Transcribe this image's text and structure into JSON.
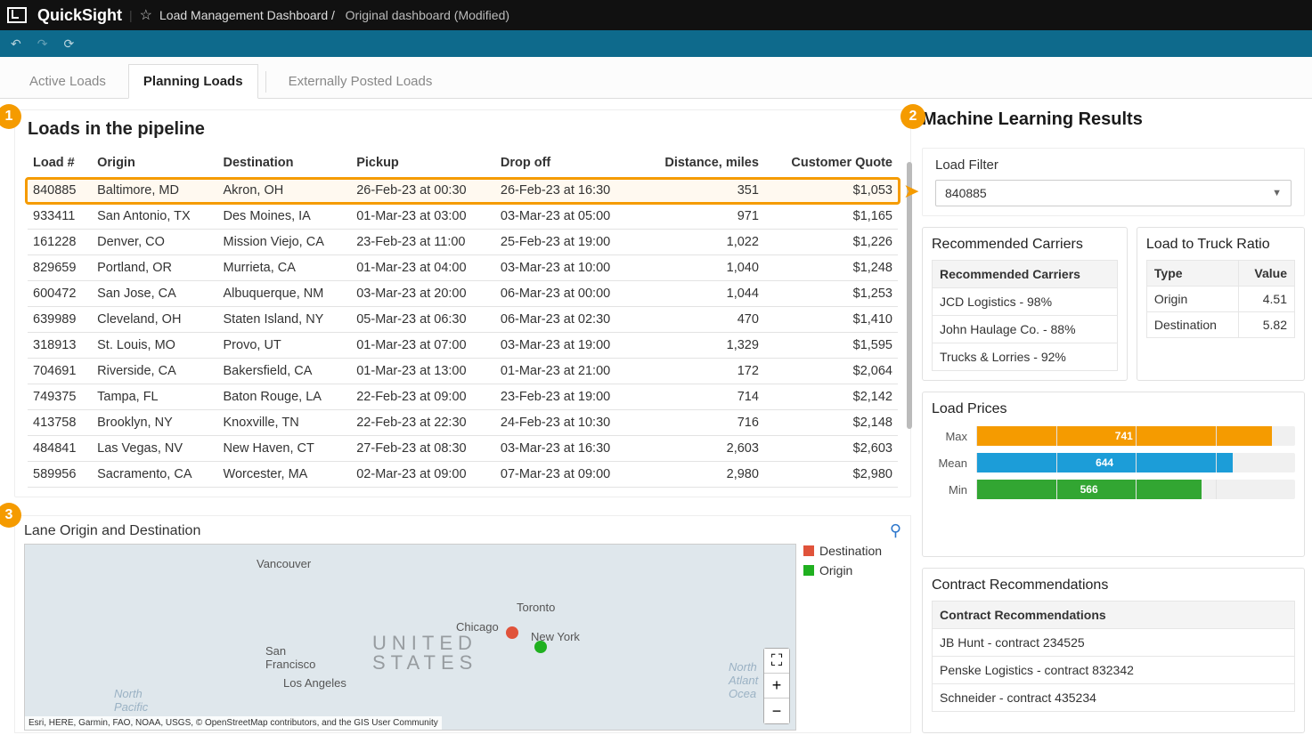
{
  "brand": "QuickSight",
  "breadcrumb": {
    "parent": "Load Management Dashboard /",
    "current": "Original dashboard (Modified)"
  },
  "tabs": [
    "Active Loads",
    "Planning Loads",
    "Externally Posted Loads"
  ],
  "active_tab": 1,
  "badges": {
    "b1": "1",
    "b2": "2",
    "b3": "3"
  },
  "pipeline": {
    "title": "Loads in the pipeline",
    "columns": [
      "Load #",
      "Origin",
      "Destination",
      "Pickup",
      "Drop off",
      "Distance, miles",
      "Customer Quote"
    ],
    "rows": [
      {
        "load": "840885",
        "origin": "Baltimore, MD",
        "dest": "Akron, OH",
        "pickup": "26-Feb-23 at 00:30",
        "dropoff": "26-Feb-23 at 16:30",
        "dist": "351",
        "quote": "$1,053",
        "hl": true
      },
      {
        "load": "933411",
        "origin": "San Antonio, TX",
        "dest": "Des Moines, IA",
        "pickup": "01-Mar-23 at 03:00",
        "dropoff": "03-Mar-23 at 05:00",
        "dist": "971",
        "quote": "$1,165"
      },
      {
        "load": "161228",
        "origin": "Denver, CO",
        "dest": "Mission Viejo, CA",
        "pickup": "23-Feb-23 at 11:00",
        "dropoff": "25-Feb-23 at 19:00",
        "dist": "1,022",
        "quote": "$1,226"
      },
      {
        "load": "829659",
        "origin": "Portland, OR",
        "dest": "Murrieta, CA",
        "pickup": "01-Mar-23 at 04:00",
        "dropoff": "03-Mar-23 at 10:00",
        "dist": "1,040",
        "quote": "$1,248"
      },
      {
        "load": "600472",
        "origin": "San Jose, CA",
        "dest": "Albuquerque, NM",
        "pickup": "03-Mar-23 at 20:00",
        "dropoff": "06-Mar-23 at 00:00",
        "dist": "1,044",
        "quote": "$1,253"
      },
      {
        "load": "639989",
        "origin": "Cleveland, OH",
        "dest": "Staten Island, NY",
        "pickup": "05-Mar-23 at 06:30",
        "dropoff": "06-Mar-23 at 02:30",
        "dist": "470",
        "quote": "$1,410"
      },
      {
        "load": "318913",
        "origin": "St. Louis, MO",
        "dest": "Provo, UT",
        "pickup": "01-Mar-23 at 07:00",
        "dropoff": "03-Mar-23 at 19:00",
        "dist": "1,329",
        "quote": "$1,595"
      },
      {
        "load": "704691",
        "origin": "Riverside, CA",
        "dest": "Bakersfield, CA",
        "pickup": "01-Mar-23 at 13:00",
        "dropoff": "01-Mar-23 at 21:00",
        "dist": "172",
        "quote": "$2,064"
      },
      {
        "load": "749375",
        "origin": "Tampa, FL",
        "dest": "Baton Rouge, LA",
        "pickup": "22-Feb-23 at 09:00",
        "dropoff": "23-Feb-23 at 19:00",
        "dist": "714",
        "quote": "$2,142"
      },
      {
        "load": "413758",
        "origin": "Brooklyn, NY",
        "dest": "Knoxville, TN",
        "pickup": "22-Feb-23 at 22:30",
        "dropoff": "24-Feb-23 at 10:30",
        "dist": "716",
        "quote": "$2,148"
      },
      {
        "load": "484841",
        "origin": "Las Vegas, NV",
        "dest": "New Haven, CT",
        "pickup": "27-Feb-23 at 08:30",
        "dropoff": "03-Mar-23 at 16:30",
        "dist": "2,603",
        "quote": "$2,603"
      },
      {
        "load": "589956",
        "origin": "Sacramento, CA",
        "dest": "Worcester, MA",
        "pickup": "02-Mar-23 at 09:00",
        "dropoff": "07-Mar-23 at 09:00",
        "dist": "2,980",
        "quote": "$2,980"
      }
    ]
  },
  "map": {
    "title": "Lane Origin and Destination",
    "legend": {
      "dest": "Destination",
      "orig": "Origin"
    },
    "labels": {
      "vancouver": "Vancouver",
      "toronto": "Toronto",
      "chicago": "Chicago",
      "newyork": "New York",
      "sf": "San\nFrancisco",
      "la": "Los Angeles",
      "us": "UNITED\nSTATES",
      "np": "North\nPacific\nOcean",
      "na": "North\nAtlant\nOcea"
    },
    "attribution": "Esri, HERE, Garmin, FAO, NOAA, USGS, © OpenStreetMap contributors, and the GIS User Community"
  },
  "ml": {
    "title": "Machine Learning Results",
    "filter_label": "Load Filter",
    "filter_value": "840885",
    "rec_title": "Recommended Carriers",
    "rec_header": "Recommended Carriers",
    "rec_items": [
      "JCD Logistics - 98%",
      "John Haulage Co. - 88%",
      "Trucks & Lorries - 92%"
    ],
    "ratio_title": "Load to Truck Ratio",
    "ratio_cols": [
      "Type",
      "Value"
    ],
    "ratio_rows": [
      [
        "Origin",
        "4.51"
      ],
      [
        "Destination",
        "5.82"
      ]
    ],
    "prices_title": "Load Prices",
    "contracts_title": "Contract Recommendations",
    "contracts_header": "Contract Recommendations",
    "contracts": [
      "JB Hunt - contract 234525",
      "Penske Logistics - contract 832342",
      "Schneider - contract 435234"
    ]
  },
  "chart_data": {
    "type": "bar",
    "orientation": "horizontal",
    "title": "Load Prices",
    "categories": [
      "Max",
      "Mean",
      "Min"
    ],
    "values": [
      741,
      644,
      566
    ],
    "colors": [
      "#f59b00",
      "#1c9dd8",
      "#32a632"
    ],
    "xlim": [
      0,
      800
    ]
  }
}
